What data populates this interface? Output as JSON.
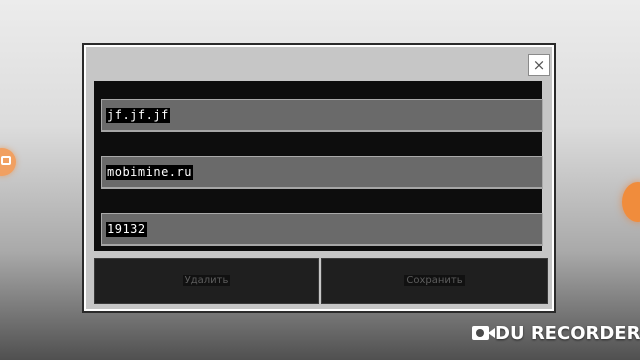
{
  "dialog": {
    "close_label": "×",
    "fields": [
      {
        "value": "jf.jf.jf"
      },
      {
        "value": "mobimine.ru"
      },
      {
        "value": "19132"
      }
    ],
    "delete_label": "Удалить",
    "save_label": "Сохранить"
  },
  "overlay": {
    "watermark": "DU RECORDER",
    "watermark_icon": "video-camera-icon"
  }
}
